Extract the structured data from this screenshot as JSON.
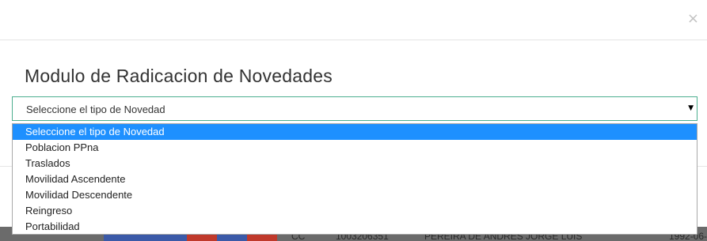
{
  "modal": {
    "close_symbol": "×",
    "title": "Modulo de Radicacion de Novedades"
  },
  "select": {
    "current_value": "Seleccione el tipo de Novedad",
    "arrow_icon": "▼",
    "options": [
      "Seleccione el tipo de Novedad",
      "Poblacion PPna",
      "Traslados",
      "Movilidad Ascendente",
      "Movilidad Descendente",
      "Reingreso",
      "Portabilidad"
    ],
    "selected_index": 0
  },
  "background_row": {
    "cells": [
      "CC",
      "1003206351",
      "PEREIRA DE ANDRES JORGE LUIS",
      "1992-06-1"
    ]
  },
  "colors": {
    "selected_option_bg": "#1e90ff",
    "select_border": "#4cae8f",
    "backdrop": "#3a3a3a"
  }
}
